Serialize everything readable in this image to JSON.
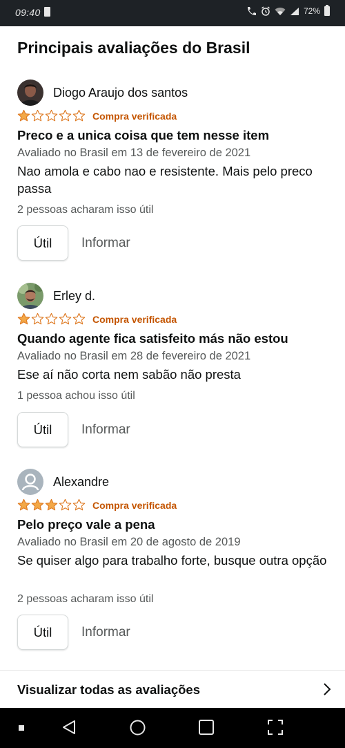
{
  "status_bar": {
    "time": "09:40",
    "battery_text": "72%"
  },
  "section": {
    "title": "Principais avaliações do Brasil"
  },
  "colors": {
    "star_filled": "#f3a847",
    "star_empty_outline": "#de7921",
    "verified": "#c45500"
  },
  "reviews": [
    {
      "reviewer": "Diogo Araujo dos santos",
      "avatar": "dark-photo-avatar",
      "rating": 1,
      "max_rating": 5,
      "verified_label": "Compra verificada",
      "title": "Preco e a unica coisa que tem nesse item",
      "date_line": "Avaliado no Brasil em 13 de fevereiro de 2021",
      "body": "Nao amola e cabo nao e resistente. Mais pelo preco passa",
      "helpful_text": "2 pessoas acharam isso útil",
      "helpful_button": "Útil",
      "report_button": "Informar"
    },
    {
      "reviewer": "Erley d.",
      "avatar": "outdoor-photo-avatar",
      "rating": 1,
      "max_rating": 5,
      "verified_label": "Compra verificada",
      "title": "Quando agente fica satisfeito más não estou",
      "date_line": "Avaliado no Brasil em 28 de fevereiro de 2021",
      "body": "Ese aí não corta nem sabão não presta",
      "helpful_text": "1 pessoa achou isso útil",
      "helpful_button": "Útil",
      "report_button": "Informar"
    },
    {
      "reviewer": "Alexandre",
      "avatar": "default-user-avatar",
      "rating": 3,
      "max_rating": 5,
      "verified_label": "Compra verificada",
      "title": "Pelo preço vale a pena",
      "date_line": "Avaliado no Brasil em 20 de agosto de 2019",
      "body": "Se quiser algo para trabalho forte, busque outra opção",
      "helpful_text": "2 pessoas acharam isso útil",
      "helpful_button": "Útil",
      "report_button": "Informar"
    }
  ],
  "see_all": {
    "label": "Visualizar todas as avaliações"
  }
}
